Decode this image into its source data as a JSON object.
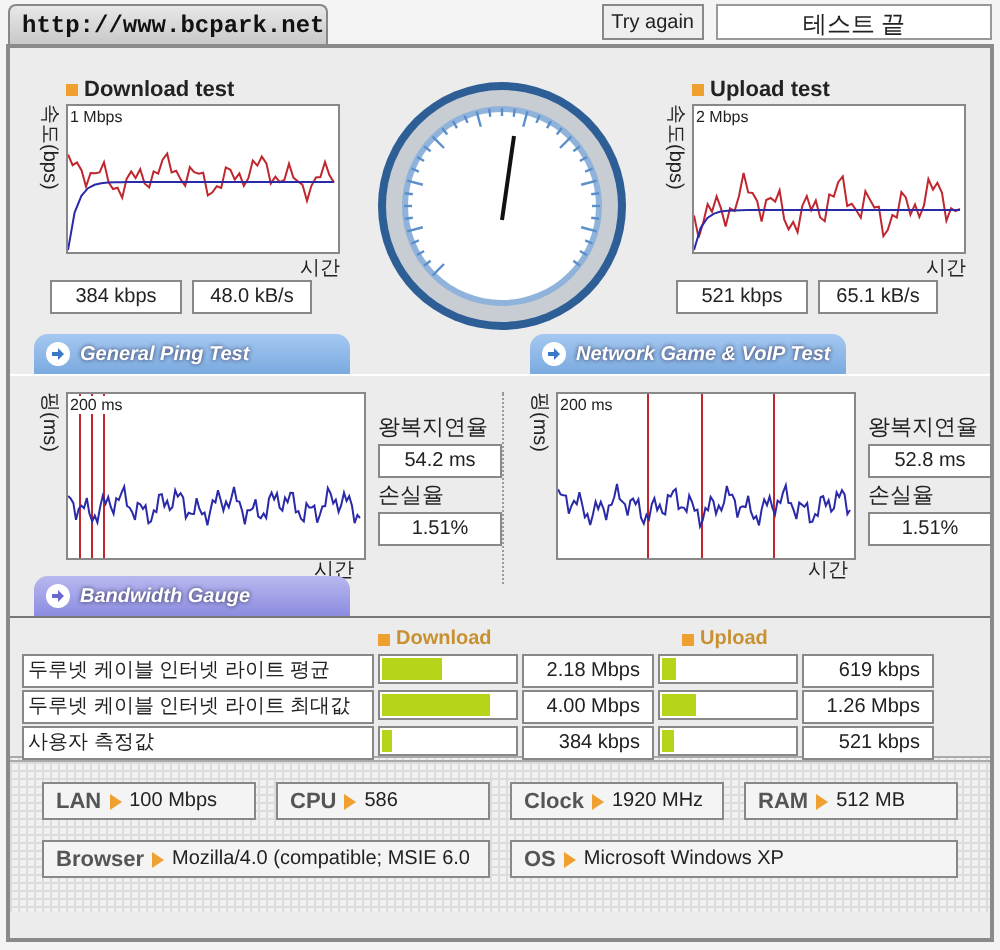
{
  "site_tab": "http://www.bcpark.net",
  "try_again": "Try again",
  "status": "테스트 끝",
  "speed_tests": [
    {
      "title": "Download test",
      "scale": "1 Mbps",
      "y_axis": "속도(bps)",
      "x_axis": "시간",
      "readings": [
        "384 kbps",
        "48.0 kB/s"
      ]
    },
    {
      "title": "Upload test",
      "scale": "2 Mbps",
      "y_axis": "속도(bps)",
      "x_axis": "시간",
      "readings": [
        "521 kbps",
        "65.1 kB/s"
      ]
    }
  ],
  "section_tabs": [
    "General Ping Test",
    "Network Game & VoIP Test"
  ],
  "ping_panels": [
    {
      "scale": "200 ms",
      "y_axis": "핑(ms)",
      "x_axis": "시간",
      "latency_label": "왕복지연율",
      "latency": "54.2 ms",
      "loss_label": "손실율",
      "loss": "1.51%"
    },
    {
      "scale": "200 ms",
      "y_axis": "핑(ms)",
      "x_axis": "시간",
      "latency_label": "왕복지연율",
      "latency": "52.8 ms",
      "loss_label": "손실율",
      "loss": "1.51%"
    }
  ],
  "bandwidth_tab": "Bandwidth Gauge",
  "bandwidth": {
    "download_header": "Download",
    "upload_header": "Upload",
    "rows": [
      {
        "label": "두루넷 케이블 인터넷 라이트 평균",
        "download": {
          "level": 0.46,
          "reading": "2.18 Mbps"
        },
        "upload": {
          "level": 0.11,
          "reading": "619 kbps"
        }
      },
      {
        "label": "두루넷 케이블 인터넷 라이트 최대값",
        "download": {
          "level": 0.82,
          "reading": "4.00 Mbps"
        },
        "upload": {
          "level": 0.26,
          "reading": "1.26 Mbps"
        }
      },
      {
        "label": "사용자 측정값",
        "download": {
          "level": 0.07,
          "reading": "384 kbps"
        },
        "upload": {
          "level": 0.09,
          "reading": "521 kbps"
        }
      }
    ]
  },
  "system_info": [
    [
      {
        "label": "LAN",
        "value": "100 Mbps"
      },
      {
        "label": "CPU",
        "value": "586"
      },
      {
        "label": "Clock",
        "value": "1920 MHz"
      },
      {
        "label": "RAM",
        "value": "512 MB"
      }
    ],
    [
      {
        "label": "Browser",
        "value": "Mozilla/4.0 (compatible; MSIE 6.0"
      },
      {
        "label": "OS",
        "value": "Microsoft Windows XP"
      }
    ]
  ]
}
